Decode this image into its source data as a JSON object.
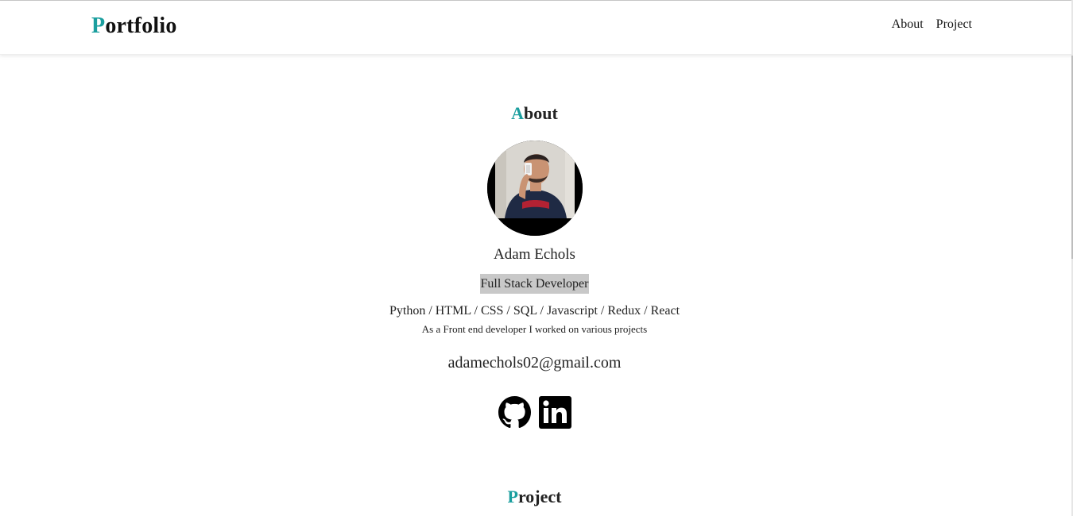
{
  "navbar": {
    "brand_initial": "P",
    "brand_rest": "ortfolio",
    "links": [
      "About",
      "Project"
    ]
  },
  "about": {
    "title_initial": "A",
    "title_rest": "bout",
    "avatar_alt": "avatar-photo",
    "name": "Adam Echols",
    "role": "Full Stack Developer",
    "skills": "Python / HTML / CSS / SQL / Javascript / Redux / React",
    "description": "As a Front end developer I worked on various projects",
    "email": "adamechols02@gmail.com",
    "social_icons": [
      "github-icon",
      "linkedin-icon"
    ]
  },
  "project": {
    "title_initial": "P",
    "title_rest": "roject"
  },
  "colors": {
    "accent": "#1a9e9e",
    "role_highlight": "#c8c8c8",
    "text": "#222222"
  }
}
